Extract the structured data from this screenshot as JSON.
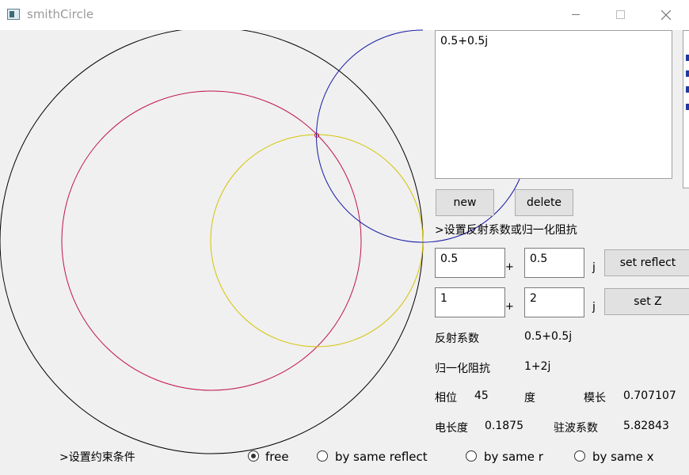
{
  "window": {
    "title": "smithCircle"
  },
  "list": {
    "items": [
      "0.5+0.5j"
    ]
  },
  "buttons": {
    "new": "new",
    "delete": "delete",
    "set_reflect": "set reflect",
    "set_z": "set Z"
  },
  "prompt_set": ">设置反射系数或归一化阻抗",
  "reflect_input": {
    "real": "0.5",
    "plus": "+",
    "imag": "0.5",
    "j": "j"
  },
  "z_input": {
    "real": "1",
    "plus": "+",
    "imag": "2",
    "j": "j"
  },
  "info": {
    "reflect_label": "反射系数",
    "reflect_value": "0.5+0.5j",
    "z_label": "归一化阻抗",
    "z_value": "1+2j",
    "phase_label": "相位",
    "phase_value": "45",
    "phase_unit": "度",
    "mag_label": "模长",
    "mag_value": "0.707107",
    "elen_label": "电长度",
    "elen_value": "0.1875",
    "vswr_label": "驻波系数",
    "vswr_value": "5.82843"
  },
  "constraint": {
    "label": ">设置约束条件",
    "options": [
      "free",
      "by same reflect",
      "by same r",
      "by same x"
    ],
    "selected": "free"
  },
  "colors": {
    "unit_circle": "#000000",
    "const_reflect": "#c0144c",
    "const_r": "#d4c400",
    "const_x": "#1a1aa6"
  }
}
